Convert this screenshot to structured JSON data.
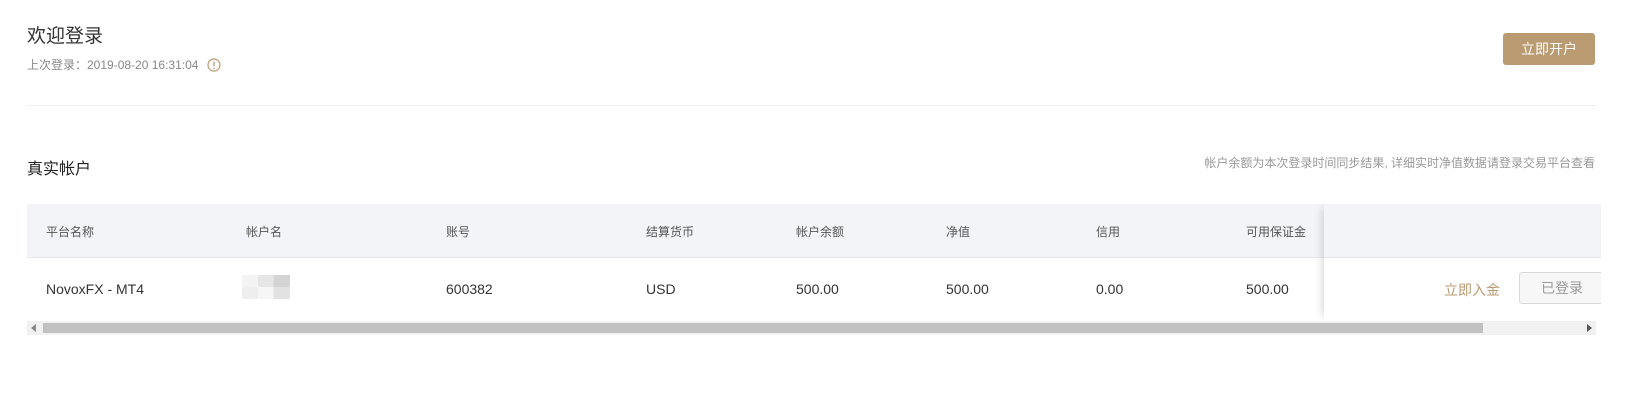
{
  "welcome": {
    "title": "欢迎登录",
    "last_login": "上次登录：2019-08-20 16:31:04",
    "info_icon": "info-circle-icon"
  },
  "open_account_button": "立即开户",
  "section": {
    "title": "真实帐户",
    "note": "帐户余额为本次登录时间同步结果, 详细实时净值数据请登录交易平台查看"
  },
  "table": {
    "columns": [
      "平台名称",
      "帐户名",
      "账号",
      "结算货币",
      "帐户余额",
      "净值",
      "信用",
      "可用保证金"
    ],
    "rows": [
      {
        "platform": "NovoxFX - MT4",
        "account_name": "",
        "account_no": "600382",
        "currency": "USD",
        "balance": "500.00",
        "equity": "500.00",
        "credit": "0.00",
        "free_margin": "500.00",
        "deposit_label": "立即入金",
        "status_button": "已登录"
      }
    ]
  },
  "colors": {
    "accent": "#b99a71",
    "header_bg": "#f2f4f7"
  }
}
